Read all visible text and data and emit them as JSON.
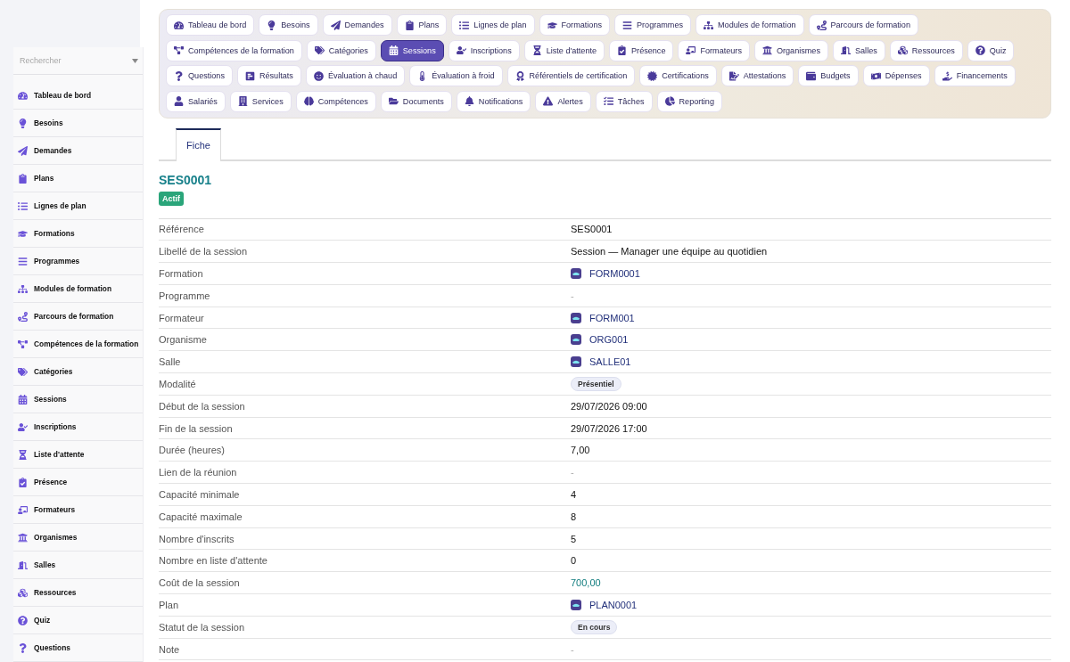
{
  "sidebar": {
    "search": {
      "placeholder": "Rechercher"
    },
    "items": [
      {
        "label": "Tableau de bord"
      },
      {
        "label": "Besoins"
      },
      {
        "label": "Demandes"
      },
      {
        "label": "Plans"
      },
      {
        "label": "Lignes de plan"
      },
      {
        "label": "Formations"
      },
      {
        "label": "Programmes"
      },
      {
        "label": "Modules de formation"
      },
      {
        "label": "Parcours de formation"
      },
      {
        "label": "Compétences de la formation"
      },
      {
        "label": "Catégories"
      },
      {
        "label": "Sessions"
      },
      {
        "label": "Inscriptions"
      },
      {
        "label": "Liste d'attente"
      },
      {
        "label": "Présence"
      },
      {
        "label": "Formateurs"
      },
      {
        "label": "Organismes"
      },
      {
        "label": "Salles"
      },
      {
        "label": "Ressources"
      },
      {
        "label": "Quiz"
      },
      {
        "label": "Questions"
      }
    ]
  },
  "nav": [
    {
      "label": "Tableau de bord",
      "selected": false
    },
    {
      "label": "Besoins",
      "selected": false
    },
    {
      "label": "Demandes",
      "selected": false
    },
    {
      "label": "Plans",
      "selected": false
    },
    {
      "label": "Lignes de plan",
      "selected": false
    },
    {
      "label": "Formations",
      "selected": false
    },
    {
      "label": "Programmes",
      "selected": false
    },
    {
      "label": "Modules de formation",
      "selected": false
    },
    {
      "label": "Parcours de formation",
      "selected": false
    },
    {
      "label": "Compétences de la formation",
      "selected": false
    },
    {
      "label": "Catégories",
      "selected": false
    },
    {
      "label": "Sessions",
      "selected": true
    },
    {
      "label": "Inscriptions",
      "selected": false
    },
    {
      "label": "Liste d'attente",
      "selected": false
    },
    {
      "label": "Présence",
      "selected": false
    },
    {
      "label": "Formateurs",
      "selected": false
    },
    {
      "label": "Organismes",
      "selected": false
    },
    {
      "label": "Salles",
      "selected": false
    },
    {
      "label": "Ressources",
      "selected": false
    },
    {
      "label": "Quiz",
      "selected": false
    },
    {
      "label": "Questions",
      "selected": false
    },
    {
      "label": "Résultats",
      "selected": false
    },
    {
      "label": "Évaluation à chaud",
      "selected": false
    },
    {
      "label": "Évaluation à froid",
      "selected": false
    },
    {
      "label": "Référentiels de certification",
      "selected": false
    },
    {
      "label": "Certifications",
      "selected": false
    },
    {
      "label": "Attestations",
      "selected": false
    },
    {
      "label": "Budgets",
      "selected": false
    },
    {
      "label": "Dépenses",
      "selected": false
    },
    {
      "label": "Financements",
      "selected": false
    },
    {
      "label": "Salariés",
      "selected": false
    },
    {
      "label": "Services",
      "selected": false
    },
    {
      "label": "Compétences",
      "selected": false
    },
    {
      "label": "Documents",
      "selected": false
    },
    {
      "label": "Notifications",
      "selected": false
    },
    {
      "label": "Alertes",
      "selected": false
    },
    {
      "label": "Tâches",
      "selected": false
    },
    {
      "label": "Reporting",
      "selected": false
    }
  ],
  "tabs": [
    {
      "label": "Fiche",
      "selected": true
    }
  ],
  "record": {
    "title": "SES0001",
    "status": "Actif",
    "fields": [
      {
        "label": "Référence",
        "kind": "text",
        "value": "SES0001"
      },
      {
        "label": "Libellé de la session",
        "kind": "text",
        "value": "Session — Manager une équipe au quotidien"
      },
      {
        "label": "Formation",
        "kind": "link",
        "value": "FORM0001"
      },
      {
        "label": "Programme",
        "kind": "empty",
        "value": "-"
      },
      {
        "label": "Formateur",
        "kind": "link",
        "value": "FORM001"
      },
      {
        "label": "Organisme",
        "kind": "link",
        "value": "ORG001"
      },
      {
        "label": "Salle",
        "kind": "link",
        "value": "SALLE01"
      },
      {
        "label": "Modalité",
        "kind": "badge",
        "value": "Présentiel"
      },
      {
        "label": "Début de la session",
        "kind": "text",
        "value": "29/07/2026 09:00"
      },
      {
        "label": "Fin de la session",
        "kind": "text",
        "value": "29/07/2026 17:00"
      },
      {
        "label": "Durée (heures)",
        "kind": "text",
        "value": "7,00"
      },
      {
        "label": "Lien de la réunion",
        "kind": "empty",
        "value": "-"
      },
      {
        "label": "Capacité minimale",
        "kind": "text",
        "value": "4"
      },
      {
        "label": "Capacité maximale",
        "kind": "text",
        "value": "8"
      },
      {
        "label": "Nombre d'inscrits",
        "kind": "text",
        "value": "5"
      },
      {
        "label": "Nombre en liste d'attente",
        "kind": "text",
        "value": "0"
      },
      {
        "label": "Coût de la session",
        "kind": "money",
        "value": "700,00"
      },
      {
        "label": "Plan",
        "kind": "link",
        "value": "PLAN0001"
      },
      {
        "label": "Statut de la session",
        "kind": "badge",
        "value": "En cours"
      },
      {
        "label": "Note",
        "kind": "empty",
        "value": "-"
      }
    ]
  }
}
